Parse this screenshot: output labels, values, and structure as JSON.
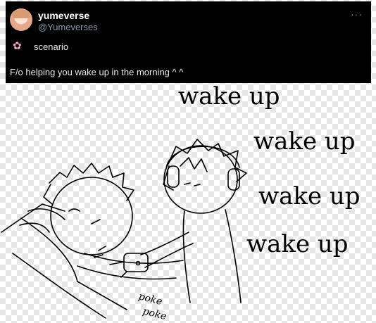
{
  "post": {
    "display_name": "yumeverse",
    "handle": "@Yumeverses",
    "more_label": "···",
    "tag_icon": "flower-icon",
    "scenario_label": "scenario",
    "body_text": "F/o helping you wake up in the morning ^ ^"
  },
  "drawing": {
    "wake_lines": [
      "wake up",
      "wake up",
      "wake up",
      "wake up"
    ],
    "poke_lines": [
      "poke",
      "poke"
    ]
  },
  "colors": {
    "post_background": "#000000",
    "text_primary": "#e7e9ea",
    "text_secondary": "#8b98a5",
    "ink": "#000000"
  }
}
